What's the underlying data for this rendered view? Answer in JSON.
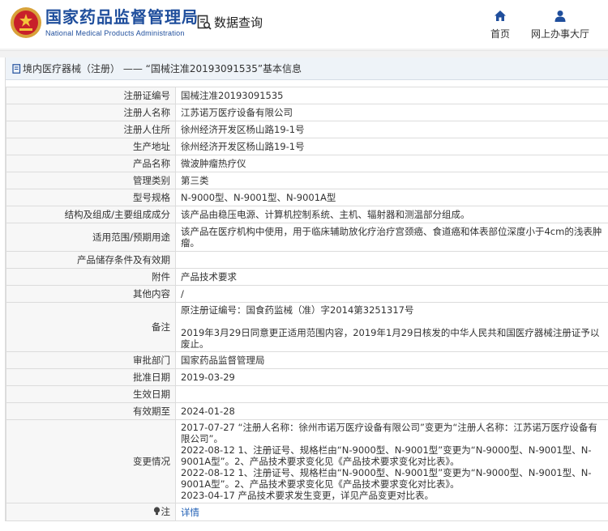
{
  "header": {
    "brand_cn": "国家药品监督管理局",
    "brand_en": "National Medical Products Administration",
    "query_label": "数据查询",
    "nav_home": "首页",
    "nav_service": "网上办事大厅"
  },
  "titlebar": {
    "text": "境内医疗器械（注册） —— “国械注准20193091535”基本信息"
  },
  "rows": [
    {
      "label": "注册证编号",
      "value": "国械注准20193091535"
    },
    {
      "label": "注册人名称",
      "value": "江苏诺万医疗设备有限公司"
    },
    {
      "label": "注册人住所",
      "value": "徐州经济开发区杨山路19-1号"
    },
    {
      "label": "生产地址",
      "value": "徐州经济开发区杨山路19-1号"
    },
    {
      "label": "产品名称",
      "value": "微波肿瘤热疗仪"
    },
    {
      "label": "管理类别",
      "value": "第三类"
    },
    {
      "label": "型号规格",
      "value": "N-9000型、N-9001型、N-9001A型"
    },
    {
      "label": "结构及组成/主要组成成分",
      "value": "该产品由稳压电源、计算机控制系统、主机、辐射器和测温部分组成。"
    },
    {
      "label": "适用范围/预期用途",
      "value": "该产品在医疗机构中使用，用于临床辅助放化疗治疗宫颈癌、食道癌和体表部位深度小于4cm的浅表肿瘤。"
    },
    {
      "label": "产品储存条件及有效期",
      "value": ""
    },
    {
      "label": "附件",
      "value": "产品技术要求"
    },
    {
      "label": "其他内容",
      "value": "/"
    },
    {
      "label": "备注",
      "value_lines": [
        "原注册证编号：国食药监械（准）字2014第3251317号",
        "2019年3月29日同意更正适用范围内容，2019年1月29日核发的中华人民共和国医疗器械注册证予以废止。"
      ]
    },
    {
      "label": "审批部门",
      "value": "国家药品监督管理局"
    },
    {
      "label": "批准日期",
      "value": "2019-03-29"
    },
    {
      "label": "生效日期",
      "value": ""
    },
    {
      "label": "有效期至",
      "value": "2024-01-28"
    },
    {
      "label": "变更情况",
      "value_lines": [
        "2017-07-27 “注册人名称：徐州市诺万医疗设备有限公司”变更为“注册人名称：江苏诺万医疗设备有限公司”。",
        "2022-08-12 1、注册证号、规格栏由“N-9000型、N-9001型”变更为“N-9000型、N-9001型、N-9001A型”。2、产品技术要求变化见《产品技术要求变化对比表》。",
        "2022-08-12 1、注册证号、规格栏由“N-9000型、N-9001型”变更为“N-9000型、N-9001型、N-9001A型”。2、产品技术要求变化见《产品技术要求变化对比表》。",
        "2023-04-17 产品技术要求发生变更，详见产品变更对比表。"
      ]
    },
    {
      "label": "注",
      "value": "详情",
      "link": true
    }
  ],
  "colors": {
    "brand": "#1f4e9c",
    "link": "#1f5fb5",
    "label_bg": "#f7f7f7",
    "titlebar_bg": "#eef3f8"
  }
}
